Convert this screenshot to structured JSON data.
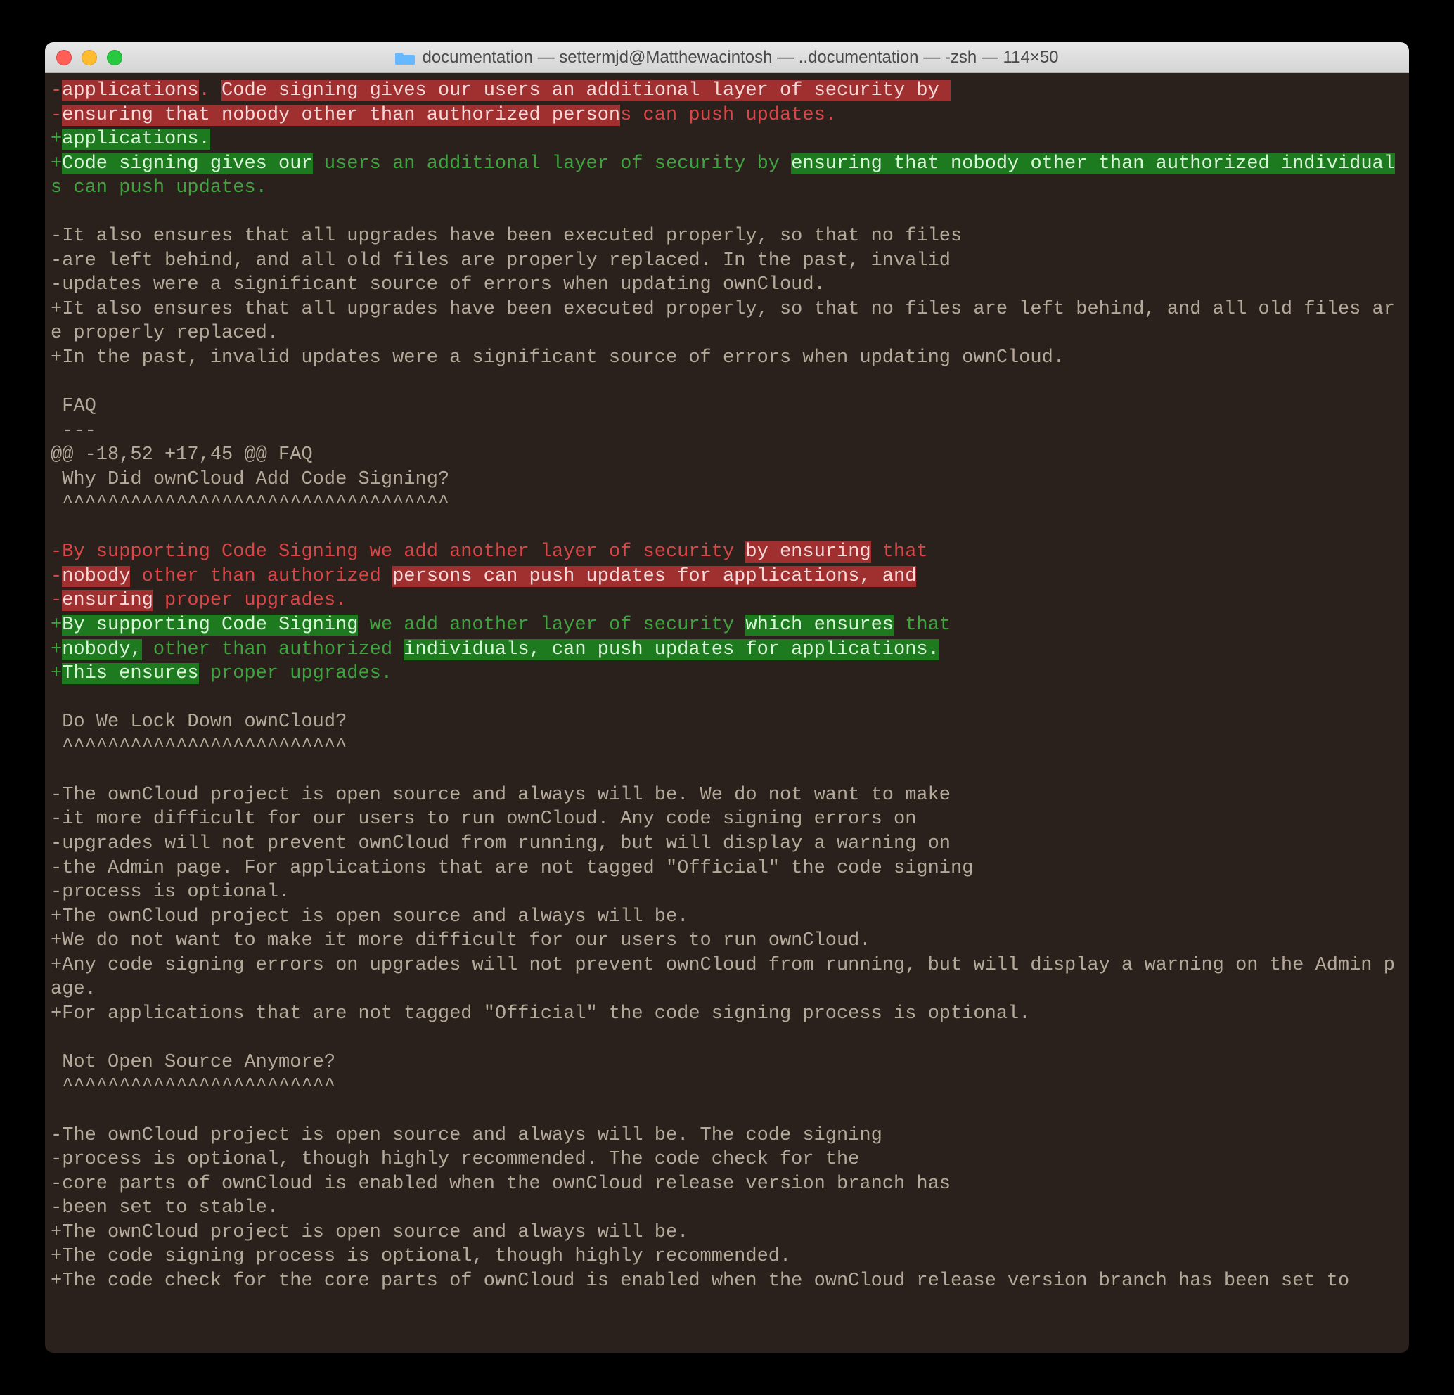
{
  "window": {
    "title": "documentation — settermjd@Matthewacintosh — ..documentation — -zsh — 114×50"
  },
  "diff": {
    "lines": [
      {
        "type": "del",
        "segments": [
          {
            "t": "-",
            "c": "minus-sign"
          },
          {
            "t": "applications",
            "c": "hl-del"
          },
          {
            "t": ". ",
            "c": "minus-sign"
          },
          {
            "t": "Code signing gives our users an additional layer of security by ",
            "c": "hl-del"
          }
        ]
      },
      {
        "type": "del",
        "segments": [
          {
            "t": "-",
            "c": "minus-sign"
          },
          {
            "t": "ensuring that nobody other than authorized person",
            "c": "hl-del"
          },
          {
            "t": "s can push updates.",
            "c": "minus-sign"
          }
        ]
      },
      {
        "type": "add",
        "segments": [
          {
            "t": "+",
            "c": "plus-sign"
          },
          {
            "t": "applications.",
            "c": "hl-add"
          }
        ]
      },
      {
        "type": "add",
        "segments": [
          {
            "t": "+",
            "c": "plus-sign"
          },
          {
            "t": "Code signing gives our",
            "c": "hl-add"
          },
          {
            "t": " users an additional layer of security by ",
            "c": "plus-sign"
          },
          {
            "t": "ensuring that nobody other than authorized individual",
            "c": "hl-add"
          },
          {
            "t": "s can push updates.",
            "c": "plus-sign"
          }
        ]
      },
      {
        "type": "blank",
        "segments": [
          {
            "t": " ",
            "c": "ctx"
          }
        ]
      },
      {
        "type": "del",
        "segments": [
          {
            "t": "-It also ensures that all upgrades have been executed properly, so that no files",
            "c": "ctx"
          }
        ]
      },
      {
        "type": "del",
        "segments": [
          {
            "t": "-are left behind, and all old files are properly replaced. In the past, invalid",
            "c": "ctx"
          }
        ]
      },
      {
        "type": "del",
        "segments": [
          {
            "t": "-updates were a significant source of errors when updating ownCloud.",
            "c": "ctx"
          }
        ]
      },
      {
        "type": "add",
        "segments": [
          {
            "t": "+It also ensures that all upgrades have been executed properly, so that no files are left behind, and all old files are properly replaced.",
            "c": "ctx"
          }
        ]
      },
      {
        "type": "add",
        "segments": [
          {
            "t": "+In the past, invalid updates were a significant source of errors when updating ownCloud.",
            "c": "ctx"
          }
        ]
      },
      {
        "type": "blank",
        "segments": [
          {
            "t": " ",
            "c": "ctx"
          }
        ]
      },
      {
        "type": "ctx",
        "segments": [
          {
            "t": " FAQ",
            "c": "ctx"
          }
        ]
      },
      {
        "type": "ctx",
        "segments": [
          {
            "t": " ---",
            "c": "ctx"
          }
        ]
      },
      {
        "type": "hunk",
        "segments": [
          {
            "t": "@@ -18,52 +17,45 @@ FAQ",
            "c": "hunk"
          }
        ]
      },
      {
        "type": "ctx",
        "segments": [
          {
            "t": " Why Did ownCloud Add Code Signing?",
            "c": "ctx"
          }
        ]
      },
      {
        "type": "ctx",
        "segments": [
          {
            "t": " ^^^^^^^^^^^^^^^^^^^^^^^^^^^^^^^^^^",
            "c": "ctx"
          }
        ]
      },
      {
        "type": "blank",
        "segments": [
          {
            "t": " ",
            "c": "ctx"
          }
        ]
      },
      {
        "type": "del",
        "segments": [
          {
            "t": "-",
            "c": "minus-sign"
          },
          {
            "t": "By supporting Code Signing",
            "c": "minus-sign"
          },
          {
            "t": " we add another layer of security ",
            "c": "minus-sign"
          },
          {
            "t": "by ensuring",
            "c": "hl-del"
          },
          {
            "t": " that",
            "c": "minus-sign"
          }
        ]
      },
      {
        "type": "del",
        "segments": [
          {
            "t": "-",
            "c": "minus-sign"
          },
          {
            "t": "nobody",
            "c": "hl-del"
          },
          {
            "t": " other than authorized ",
            "c": "minus-sign"
          },
          {
            "t": "persons can push updates for applications, and",
            "c": "hl-del"
          }
        ]
      },
      {
        "type": "del",
        "segments": [
          {
            "t": "-",
            "c": "minus-sign"
          },
          {
            "t": "ensuring",
            "c": "hl-del"
          },
          {
            "t": " proper upgrades.",
            "c": "minus-sign"
          }
        ]
      },
      {
        "type": "add",
        "segments": [
          {
            "t": "+",
            "c": "plus-sign"
          },
          {
            "t": "By supporting Code Signing",
            "c": "hl-add"
          },
          {
            "t": " we add another layer of security ",
            "c": "plus-sign"
          },
          {
            "t": "which ensures",
            "c": "hl-add"
          },
          {
            "t": " that",
            "c": "plus-sign"
          }
        ]
      },
      {
        "type": "add",
        "segments": [
          {
            "t": "+",
            "c": "plus-sign"
          },
          {
            "t": "nobody,",
            "c": "hl-add"
          },
          {
            "t": " other than authorized ",
            "c": "plus-sign"
          },
          {
            "t": "individuals, can push updates for applications.",
            "c": "hl-add"
          }
        ]
      },
      {
        "type": "add",
        "segments": [
          {
            "t": "+",
            "c": "plus-sign"
          },
          {
            "t": "This ensures",
            "c": "hl-add"
          },
          {
            "t": " proper upgrades.",
            "c": "plus-sign"
          }
        ]
      },
      {
        "type": "blank",
        "segments": [
          {
            "t": " ",
            "c": "ctx"
          }
        ]
      },
      {
        "type": "ctx",
        "segments": [
          {
            "t": " Do We Lock Down ownCloud?",
            "c": "ctx"
          }
        ]
      },
      {
        "type": "ctx",
        "segments": [
          {
            "t": " ^^^^^^^^^^^^^^^^^^^^^^^^^",
            "c": "ctx"
          }
        ]
      },
      {
        "type": "blank",
        "segments": [
          {
            "t": " ",
            "c": "ctx"
          }
        ]
      },
      {
        "type": "del",
        "segments": [
          {
            "t": "-The ownCloud project is open source and always will be. We do not want to make",
            "c": "ctx"
          }
        ]
      },
      {
        "type": "del",
        "segments": [
          {
            "t": "-it more difficult for our users to run ownCloud. Any code signing errors on",
            "c": "ctx"
          }
        ]
      },
      {
        "type": "del",
        "segments": [
          {
            "t": "-upgrades will not prevent ownCloud from running, but will display a warning on",
            "c": "ctx"
          }
        ]
      },
      {
        "type": "del",
        "segments": [
          {
            "t": "-the Admin page. For applications that are not tagged \"Official\" the code signing",
            "c": "ctx"
          }
        ]
      },
      {
        "type": "del",
        "segments": [
          {
            "t": "-process is optional.",
            "c": "ctx"
          }
        ]
      },
      {
        "type": "add",
        "segments": [
          {
            "t": "+The ownCloud project is open source and always will be.",
            "c": "ctx"
          }
        ]
      },
      {
        "type": "add",
        "segments": [
          {
            "t": "+We do not want to make it more difficult for our users to run ownCloud.",
            "c": "ctx"
          }
        ]
      },
      {
        "type": "add",
        "segments": [
          {
            "t": "+Any code signing errors on upgrades will not prevent ownCloud from running, but will display a warning on the Admin page.",
            "c": "ctx"
          }
        ]
      },
      {
        "type": "add",
        "segments": [
          {
            "t": "+For applications that are not tagged \"Official\" the code signing process is optional.",
            "c": "ctx"
          }
        ]
      },
      {
        "type": "blank",
        "segments": [
          {
            "t": " ",
            "c": "ctx"
          }
        ]
      },
      {
        "type": "ctx",
        "segments": [
          {
            "t": " Not Open Source Anymore?",
            "c": "ctx"
          }
        ]
      },
      {
        "type": "ctx",
        "segments": [
          {
            "t": " ^^^^^^^^^^^^^^^^^^^^^^^^",
            "c": "ctx"
          }
        ]
      },
      {
        "type": "blank",
        "segments": [
          {
            "t": " ",
            "c": "ctx"
          }
        ]
      },
      {
        "type": "del",
        "segments": [
          {
            "t": "-The ownCloud project is open source and always will be. The code signing",
            "c": "ctx"
          }
        ]
      },
      {
        "type": "del",
        "segments": [
          {
            "t": "-process is optional, though highly recommended. The code check for the",
            "c": "ctx"
          }
        ]
      },
      {
        "type": "del",
        "segments": [
          {
            "t": "-core parts of ownCloud is enabled when the ownCloud release version branch has",
            "c": "ctx"
          }
        ]
      },
      {
        "type": "del",
        "segments": [
          {
            "t": "-been set to stable.",
            "c": "ctx"
          }
        ]
      },
      {
        "type": "add",
        "segments": [
          {
            "t": "+The ownCloud project is open source and always will be.",
            "c": "ctx"
          }
        ]
      },
      {
        "type": "add",
        "segments": [
          {
            "t": "+The code signing process is optional, though highly recommended.",
            "c": "ctx"
          }
        ]
      },
      {
        "type": "add",
        "segments": [
          {
            "t": "+The code check for the core parts of ownCloud is enabled when the ownCloud release version branch has been set to",
            "c": "ctx"
          }
        ]
      }
    ]
  }
}
